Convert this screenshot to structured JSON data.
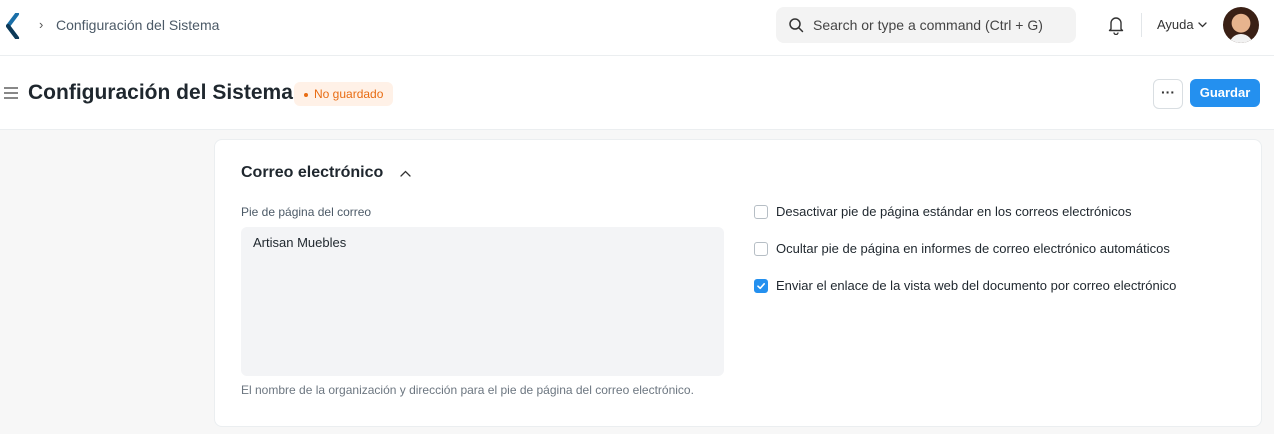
{
  "colors": {
    "accent": "#2490ef",
    "warning": "#e86c13",
    "warning_bg": "#fff1e7"
  },
  "topbar": {
    "breadcrumb": "Configuración del Sistema",
    "search_placeholder": "Search or type a command (Ctrl + G)",
    "help_label": "Ayuda"
  },
  "page": {
    "title": "Configuración del Sistema",
    "status": "No guardado",
    "more_label": "···",
    "save_label": "Guardar"
  },
  "section": {
    "title": "Correo electrónico",
    "email_footer": {
      "label": "Pie de página del correo",
      "value": "Artisan Muebles",
      "description": "El nombre de la organización y dirección para el pie de página del correo electrónico."
    },
    "checkboxes": [
      {
        "label": "Desactivar pie de página estándar en los correos electrónicos",
        "checked": false
      },
      {
        "label": "Ocultar pie de página en informes de correo electrónico automáticos",
        "checked": false
      },
      {
        "label": "Enviar el enlace de la vista web del documento por correo electrónico",
        "checked": true
      }
    ]
  }
}
